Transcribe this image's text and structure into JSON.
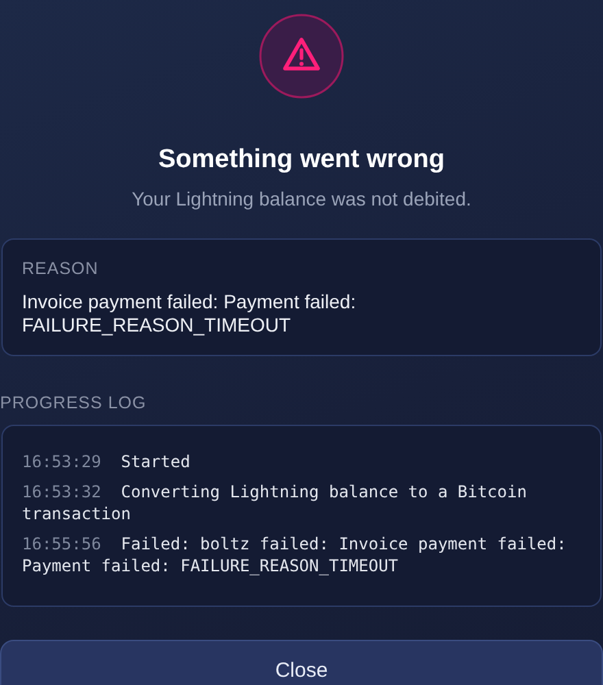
{
  "title": "Something went wrong",
  "subtitle": "Your Lightning balance was not debited.",
  "reason": {
    "label": "REASON",
    "text": "Invoice payment failed: Payment failed: FAILURE_REASON_TIMEOUT"
  },
  "progress_log": {
    "label": "PROGRESS LOG",
    "entries": [
      {
        "time": "16:53:29",
        "message": "Started"
      },
      {
        "time": "16:53:32",
        "message": "Converting Lightning balance to a Bitcoin transaction"
      },
      {
        "time": "16:55:56",
        "message": "Failed: boltz failed: Invoice payment failed: Payment failed: FAILURE_REASON_TIMEOUT"
      }
    ]
  },
  "buttons": [
    "Close"
  ]
}
